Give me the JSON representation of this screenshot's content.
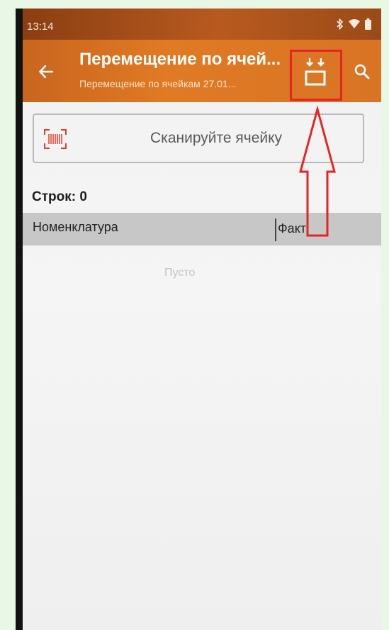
{
  "status_bar": {
    "time": "13:14",
    "icons": [
      "bluetooth-icon",
      "wifi-icon",
      "battery-icon"
    ]
  },
  "toolbar": {
    "back_icon": "arrow-left-icon",
    "title": "Перемещение по ячей...",
    "subtitle": "Перемещение по ячейкам 27.01...",
    "action_icon": "move-to-cell-icon",
    "search_icon": "search-icon",
    "highlight_color": "#e52525"
  },
  "scan_field": {
    "icon": "barcode-icon",
    "placeholder": "Сканируйте ячейку"
  },
  "summary": {
    "rows_count": "Строк: 0"
  },
  "table": {
    "columns": [
      "Номенклатура",
      "Факт"
    ],
    "empty_text": "Пусто"
  },
  "colors": {
    "toolbar": "#e07a24",
    "status_bar": "#9b4a18",
    "annotation": "#e52525"
  }
}
